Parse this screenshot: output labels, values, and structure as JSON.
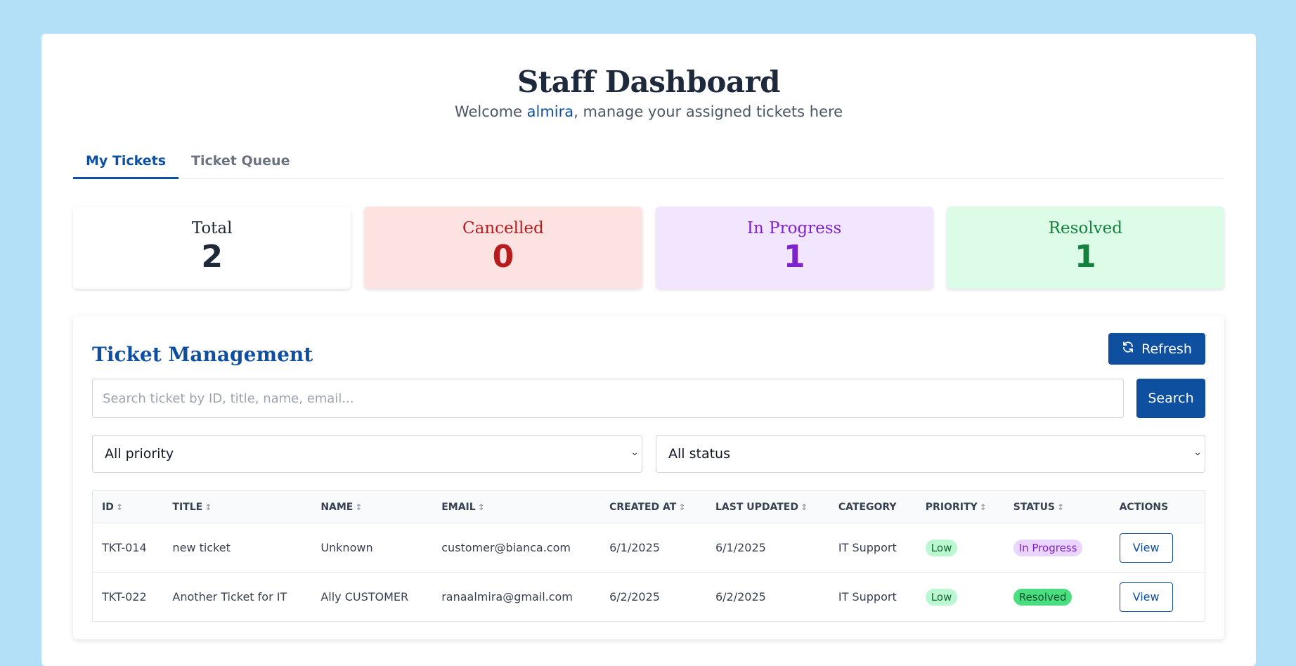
{
  "header": {
    "title": "Staff Dashboard",
    "welcome_prefix": "Welcome ",
    "username": "almira",
    "welcome_suffix": ", manage your assigned tickets here"
  },
  "tabs": [
    {
      "label": "My Tickets",
      "active": true
    },
    {
      "label": "Ticket Queue",
      "active": false
    }
  ],
  "stats": [
    {
      "label": "Total",
      "value": "2"
    },
    {
      "label": "Cancelled",
      "value": "0"
    },
    {
      "label": "In Progress",
      "value": "1"
    },
    {
      "label": "Resolved",
      "value": "1"
    }
  ],
  "panel": {
    "title": "Ticket Management",
    "refresh_label": "Refresh",
    "search_placeholder": "Search ticket by ID, title, name, email...",
    "search_value": "",
    "search_label": "Search",
    "priority_filter": "All priority",
    "status_filter": "All status"
  },
  "table": {
    "columns": [
      {
        "label": "ID",
        "sortable": true
      },
      {
        "label": "TITLE",
        "sortable": true
      },
      {
        "label": "NAME",
        "sortable": true
      },
      {
        "label": "EMAIL",
        "sortable": true
      },
      {
        "label": "CREATED AT",
        "sortable": true
      },
      {
        "label": "LAST UPDATED",
        "sortable": true
      },
      {
        "label": "CATEGORY",
        "sortable": false
      },
      {
        "label": "PRIORITY",
        "sortable": true
      },
      {
        "label": "STATUS",
        "sortable": true
      },
      {
        "label": "ACTIONS",
        "sortable": false
      }
    ],
    "sort_glyph": "↕",
    "rows": [
      {
        "id": "TKT-014",
        "title": "new ticket",
        "name": "Unknown",
        "email": "customer@bianca.com",
        "created": "6/1/2025",
        "updated": "6/1/2025",
        "category": "IT Support",
        "priority": "Low",
        "status": "In Progress",
        "action": "View"
      },
      {
        "id": "TKT-022",
        "title": "Another Ticket for IT",
        "name": "Ally CUSTOMER",
        "email": "ranaalmira@gmail.com",
        "created": "6/2/2025",
        "updated": "6/2/2025",
        "category": "IT Support",
        "priority": "Low",
        "status": "Resolved",
        "action": "View"
      }
    ]
  },
  "colors": {
    "page_bg": "#b3dff7",
    "brand": "#0f4fa0",
    "cancelled": "#b91c1c",
    "in_progress": "#7e22ce",
    "resolved": "#15803d"
  }
}
